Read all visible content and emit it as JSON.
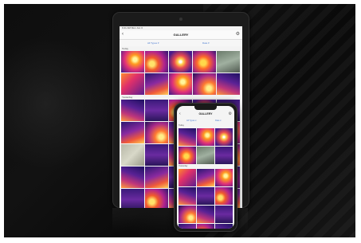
{
  "tablet": {
    "status_left": "9:41 AM  Mon Jun 3",
    "back": "‹",
    "title": "GALLERY",
    "filter_left": "All Types ▾",
    "filter_right": "Date ▾",
    "section1": "Today",
    "section2": "Yesterday",
    "tiles_row1": [
      "th1",
      "th2",
      "th4",
      "th10",
      "photo2"
    ],
    "tiles_row2": [
      "th7",
      "th3",
      "th1",
      "th6",
      "th5"
    ],
    "tiles_row3": [
      "th5",
      "th9",
      "th2",
      "th4",
      "th9"
    ],
    "tiles_row4": [
      "th3",
      "th6",
      "th5",
      "th9",
      "th1"
    ],
    "tiles_row5": [
      "photo",
      "th9",
      "th5",
      "th2",
      "th6"
    ],
    "tiles_row6": [
      "th5",
      "th3",
      "th9",
      "th7",
      "th2"
    ],
    "tiles_row7": [
      "th9",
      "th2",
      "th5",
      "th9",
      "th3"
    ]
  },
  "phone": {
    "back": "‹",
    "title": "GALLERY",
    "filter_left": "All Types ▾",
    "filter_right": "Date ▾",
    "section1": "Today",
    "section2": "Yesterday",
    "tiles_top": [
      "th5",
      "th1",
      "th4",
      "th10",
      "photo2",
      "th9"
    ],
    "tiles_bottom": [
      "th7",
      "th3",
      "th1",
      "th5",
      "th9",
      "th2",
      "th6",
      "th5",
      "th9",
      "th3",
      "th2",
      "th5"
    ]
  }
}
